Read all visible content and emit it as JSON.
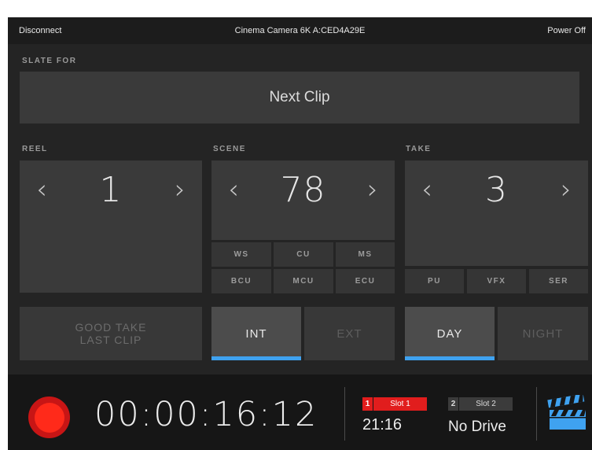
{
  "topbar": {
    "disconnect": "Disconnect",
    "device": "Cinema Camera 6K A:CED4A29E",
    "power": "Power Off"
  },
  "slate": {
    "label": "SLATE FOR",
    "value": "Next Clip"
  },
  "reel": {
    "label": "REEL",
    "value": "1",
    "prev": "‹",
    "next": "›"
  },
  "scene": {
    "label": "SCENE",
    "value": "78",
    "prev": "‹",
    "next": "›",
    "shots": [
      "WS",
      "CU",
      "MS",
      "BCU",
      "MCU",
      "ECU"
    ]
  },
  "take": {
    "label": "TAKE",
    "value": "3",
    "prev": "‹",
    "next": "›",
    "tags": [
      "PU",
      "VFX",
      "SER"
    ]
  },
  "toggles": {
    "good_take": [
      "GOOD TAKE",
      "LAST CLIP"
    ],
    "int": "INT",
    "ext": "EXT",
    "day": "DAY",
    "night": "NIGHT"
  },
  "status": {
    "timecode": "00:00:16:12",
    "slot1": {
      "num": "1",
      "name": "Slot 1",
      "value": "21:16"
    },
    "slot2": {
      "num": "2",
      "name": "Slot 2",
      "value": "No Drive"
    }
  },
  "icons": {
    "record": "record-icon",
    "slate": "clapperboard-icon"
  },
  "colors": {
    "accent": "#3fa2f0",
    "record": "#ff2a1a",
    "slot_active": "#e11d1d"
  }
}
